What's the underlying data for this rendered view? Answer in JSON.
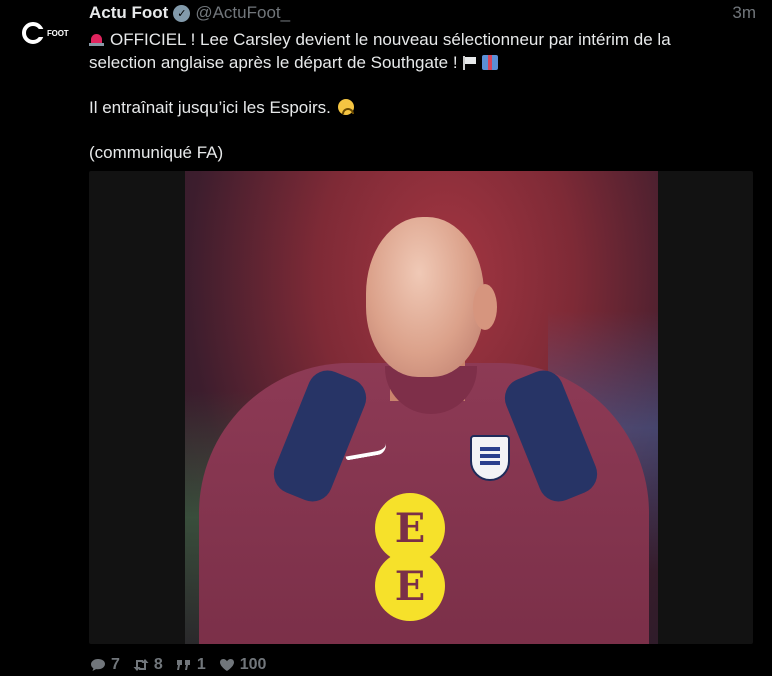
{
  "tweet": {
    "author_name": "Actu Foot",
    "handle": "@ActuFoot_",
    "timestamp": "3m",
    "avatar_label": "FOOT",
    "text_line1": "OFFICIEL ! Lee Carsley devient le nouveau sélectionneur par intérim de la",
    "text_line2": "selection anglaise après le départ de Southgate !",
    "text_para2": "Il entraînait jusqu’ici les Espoirs.",
    "text_para3": "(communiqué FA)",
    "sponsor_letter": "E"
  },
  "actions": {
    "replies": "7",
    "retweets": "8",
    "quotes": "1",
    "likes": "100"
  },
  "icons": {
    "verified": "verified-badge-icon",
    "siren": "siren-emoji-icon",
    "flag": "black-flag-emoji-icon",
    "gift": "gift-emoji-icon",
    "sad": "crying-face-emoji-icon",
    "reply": "speech-bubble-icon",
    "retweet": "retweet-icon",
    "quote": "quote-icon",
    "like": "heart-icon"
  },
  "colors": {
    "background": "#000000",
    "text": "#e7e9ea",
    "muted": "#71767b",
    "jersey": "#7a2f48"
  }
}
